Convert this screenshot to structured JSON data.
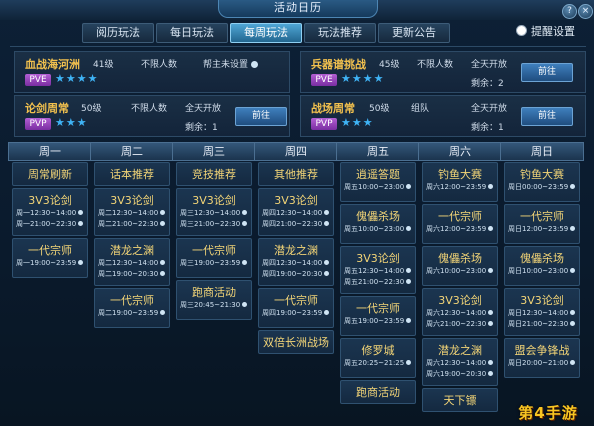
{
  "window": {
    "title": "活动日历"
  },
  "tabs": [
    {
      "label": "阅历玩法"
    },
    {
      "label": "每日玩法"
    },
    {
      "label": "每周玩法",
      "active": true
    },
    {
      "label": "玩法推荐"
    },
    {
      "label": "更新公告"
    }
  ],
  "remind_label": "提醒设置",
  "featured": [
    {
      "name": "血战海河洲",
      "level": "41级",
      "crowd": "不限人数",
      "time": "帮主未设置",
      "remaining": "",
      "mode": "PVE",
      "stars": "★★★★",
      "button": ""
    },
    {
      "name": "兵器谱挑战",
      "level": "45级",
      "crowd": "不限人数",
      "time": "全天开放",
      "remaining": "剩余：2",
      "mode": "PVE",
      "stars": "★★★★",
      "button": "前往"
    },
    {
      "name": "论剑周常",
      "level": "50级",
      "crowd": "不限人数",
      "time": "全天开放",
      "remaining": "剩余：1",
      "mode": "PVP",
      "stars": "★★★",
      "button": "前往"
    },
    {
      "name": "战场周常",
      "level": "50级",
      "crowd": "组队",
      "time": "全天开放",
      "remaining": "剩余：1",
      "mode": "PVP",
      "stars": "★★★",
      "button": "前往"
    }
  ],
  "days": [
    "周一",
    "周二",
    "周三",
    "周四",
    "周五",
    "周六",
    "周日"
  ],
  "schedule": [
    [
      {
        "name": "周常刷新",
        "lines": []
      },
      {
        "name": "3V3论剑",
        "lines": [
          "周一12:30~14:00",
          "周一21:00~22:30"
        ]
      },
      {
        "name": "一代宗师",
        "lines": [
          "周一19:00~23:59"
        ]
      }
    ],
    [
      {
        "name": "话本推荐",
        "lines": []
      },
      {
        "name": "3V3论剑",
        "lines": [
          "周二12:30~14:00",
          "周二21:00~22:30"
        ]
      },
      {
        "name": "潜龙之渊",
        "lines": [
          "周二12:30~14:00",
          "周二19:00~20:30"
        ]
      },
      {
        "name": "一代宗师",
        "lines": [
          "周二19:00~23:59"
        ]
      }
    ],
    [
      {
        "name": "竞技推荐",
        "lines": []
      },
      {
        "name": "3V3论剑",
        "lines": [
          "周三12:30~14:00",
          "周三21:00~22:30"
        ]
      },
      {
        "name": "一代宗师",
        "lines": [
          "周三19:00~23:59"
        ]
      },
      {
        "name": "跑商活动",
        "lines": [
          "周三20:45~21:30"
        ]
      }
    ],
    [
      {
        "name": "其他推荐",
        "lines": []
      },
      {
        "name": "3V3论剑",
        "lines": [
          "周四12:30~14:00",
          "周四21:00~22:30"
        ]
      },
      {
        "name": "潜龙之渊",
        "lines": [
          "周四12:30~14:00",
          "周四19:00~20:30"
        ]
      },
      {
        "name": "一代宗师",
        "lines": [
          "周四19:00~23:59"
        ]
      },
      {
        "name": "双倍长洲战场",
        "lines": []
      }
    ],
    [
      {
        "name": "逍遥答题",
        "lines": [
          "周五10:00~23:00"
        ]
      },
      {
        "name": "傀儡杀场",
        "lines": [
          "周五10:00~23:00"
        ]
      },
      {
        "name": "3V3论剑",
        "lines": [
          "周五12:30~14:00",
          "周五21:00~22:30"
        ]
      },
      {
        "name": "一代宗师",
        "lines": [
          "周五19:00~23:59"
        ]
      },
      {
        "name": "修罗城",
        "lines": [
          "周五20:25~21:25"
        ]
      },
      {
        "name": "跑商活动",
        "lines": []
      }
    ],
    [
      {
        "name": "钓鱼大赛",
        "lines": [
          "周六12:00~23:59"
        ]
      },
      {
        "name": "一代宗师",
        "lines": [
          "周六12:00~23:59"
        ]
      },
      {
        "name": "傀儡杀场",
        "lines": [
          "周六10:00~23:00"
        ]
      },
      {
        "name": "3V3论剑",
        "lines": [
          "周六12:30~14:00",
          "周六21:00~22:30"
        ]
      },
      {
        "name": "潜龙之渊",
        "lines": [
          "周六12:30~14:00",
          "周六19:00~20:30"
        ]
      },
      {
        "name": "天下镖",
        "lines": []
      }
    ],
    [
      {
        "name": "钓鱼大赛",
        "lines": [
          "周日00:00~23:59"
        ]
      },
      {
        "name": "一代宗师",
        "lines": [
          "周日12:00~23:59"
        ]
      },
      {
        "name": "傀儡杀场",
        "lines": [
          "周日10:00~23:00"
        ]
      },
      {
        "name": "3V3论剑",
        "lines": [
          "周日12:30~14:00",
          "周日21:00~22:30"
        ]
      },
      {
        "name": "盟会争锋战",
        "lines": [
          "周日20:00~21:00"
        ]
      }
    ]
  ],
  "watermark": "第4手游"
}
